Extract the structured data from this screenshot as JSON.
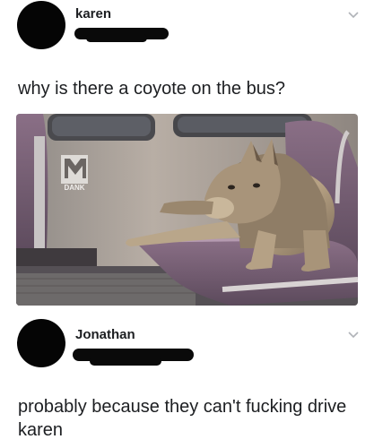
{
  "post": {
    "username": "karen",
    "text": "why is there a coyote on the bus?",
    "watermark": "DANK"
  },
  "reply": {
    "username": "Jonathan",
    "text": "probably because they can't fucking drive karen"
  },
  "icons": {
    "avatar": "avatar-silhouette",
    "menu": "chevron-down-icon"
  }
}
